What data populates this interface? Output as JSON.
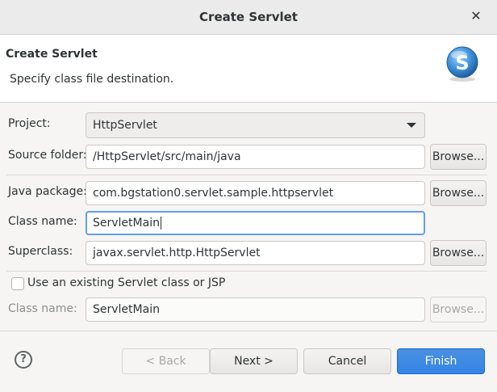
{
  "window": {
    "title": "Create Servlet",
    "close_glyph": "✕"
  },
  "header": {
    "title": "Create Servlet",
    "description": "Specify class file destination.",
    "logo_letter": "S"
  },
  "form": {
    "project": {
      "label": "Project:",
      "value": "HttpServlet"
    },
    "source_folder": {
      "label": "Source folder:",
      "value": "/HttpServlet/src/main/java",
      "browse": "Browse..."
    },
    "java_package": {
      "label": "Java package:",
      "value": "com.bgstation0.servlet.sample.httpservlet",
      "browse": "Browse..."
    },
    "class_name": {
      "label": "Class name:",
      "value": "ServletMain"
    },
    "superclass": {
      "label": "Superclass:",
      "value": "javax.servlet.http.HttpServlet",
      "browse": "Browse..."
    },
    "existing": {
      "label": "Use an existing Servlet class or JSP",
      "checked": false
    },
    "existing_class_name": {
      "label": "Class name:",
      "value": "ServletMain",
      "browse": "Browse..."
    }
  },
  "footer": {
    "help_glyph": "?",
    "back": "< Back",
    "next": "Next >",
    "cancel": "Cancel",
    "finish": "Finish"
  },
  "colors": {
    "accent": "#3584e4",
    "focus": "#62a0ea",
    "logo": "#3b8fd9"
  }
}
